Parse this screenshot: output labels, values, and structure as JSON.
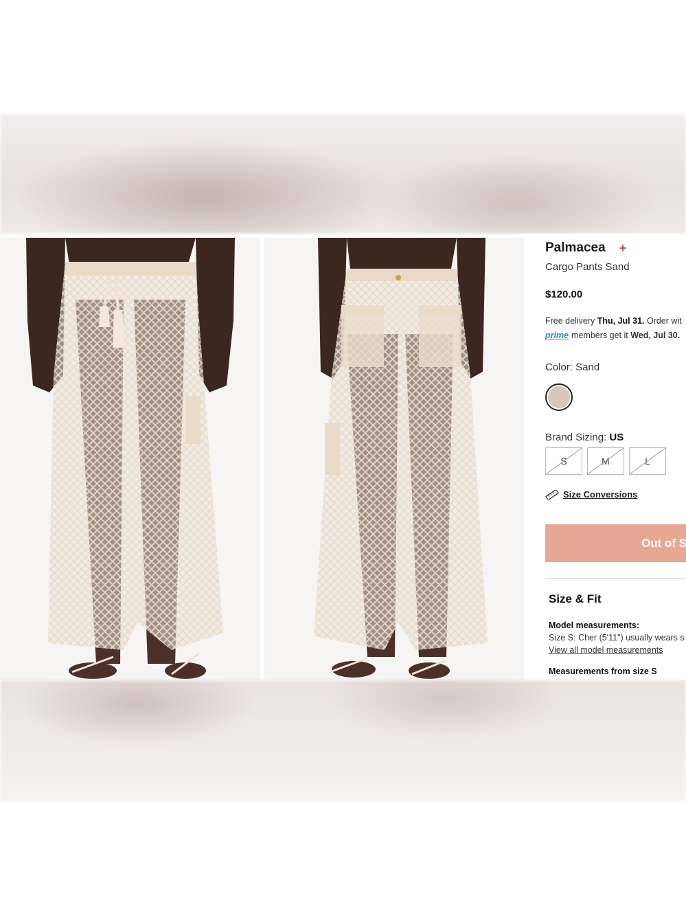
{
  "product": {
    "brand": "Palmacea",
    "name": "Cargo Pants Sand",
    "price": "$120.00"
  },
  "delivery": {
    "prefix": "Free delivery ",
    "date": "Thu, Jul 31.",
    "suffix": " Order wit",
    "prime_label": "prime",
    "prime_prefix": "members get it ",
    "prime_date": "Wed, Jul 30."
  },
  "color": {
    "label": "Color: Sand",
    "swatch_hex": "#d9c6b6"
  },
  "sizing": {
    "label": "Brand Sizing: ",
    "system": "US",
    "sizes": [
      "S",
      "M",
      "L"
    ],
    "availability": "all sizes crossed out"
  },
  "size_conversions": "Size Conversions",
  "cta": {
    "label": "Out of S",
    "color": "#e7a795"
  },
  "size_fit": {
    "title": "Size & Fit",
    "model_label": "Model measurements:",
    "model_text": "Size S: Cher (5'11\") usually wears s",
    "model_link": "View all model measurements",
    "measurements_label": "Measurements from size S"
  },
  "icons": {
    "plus": "plus-icon",
    "ruler": "ruler-icon"
  },
  "colors": {
    "accent": "#c8553b",
    "prime_blue": "#1a8fd1"
  }
}
